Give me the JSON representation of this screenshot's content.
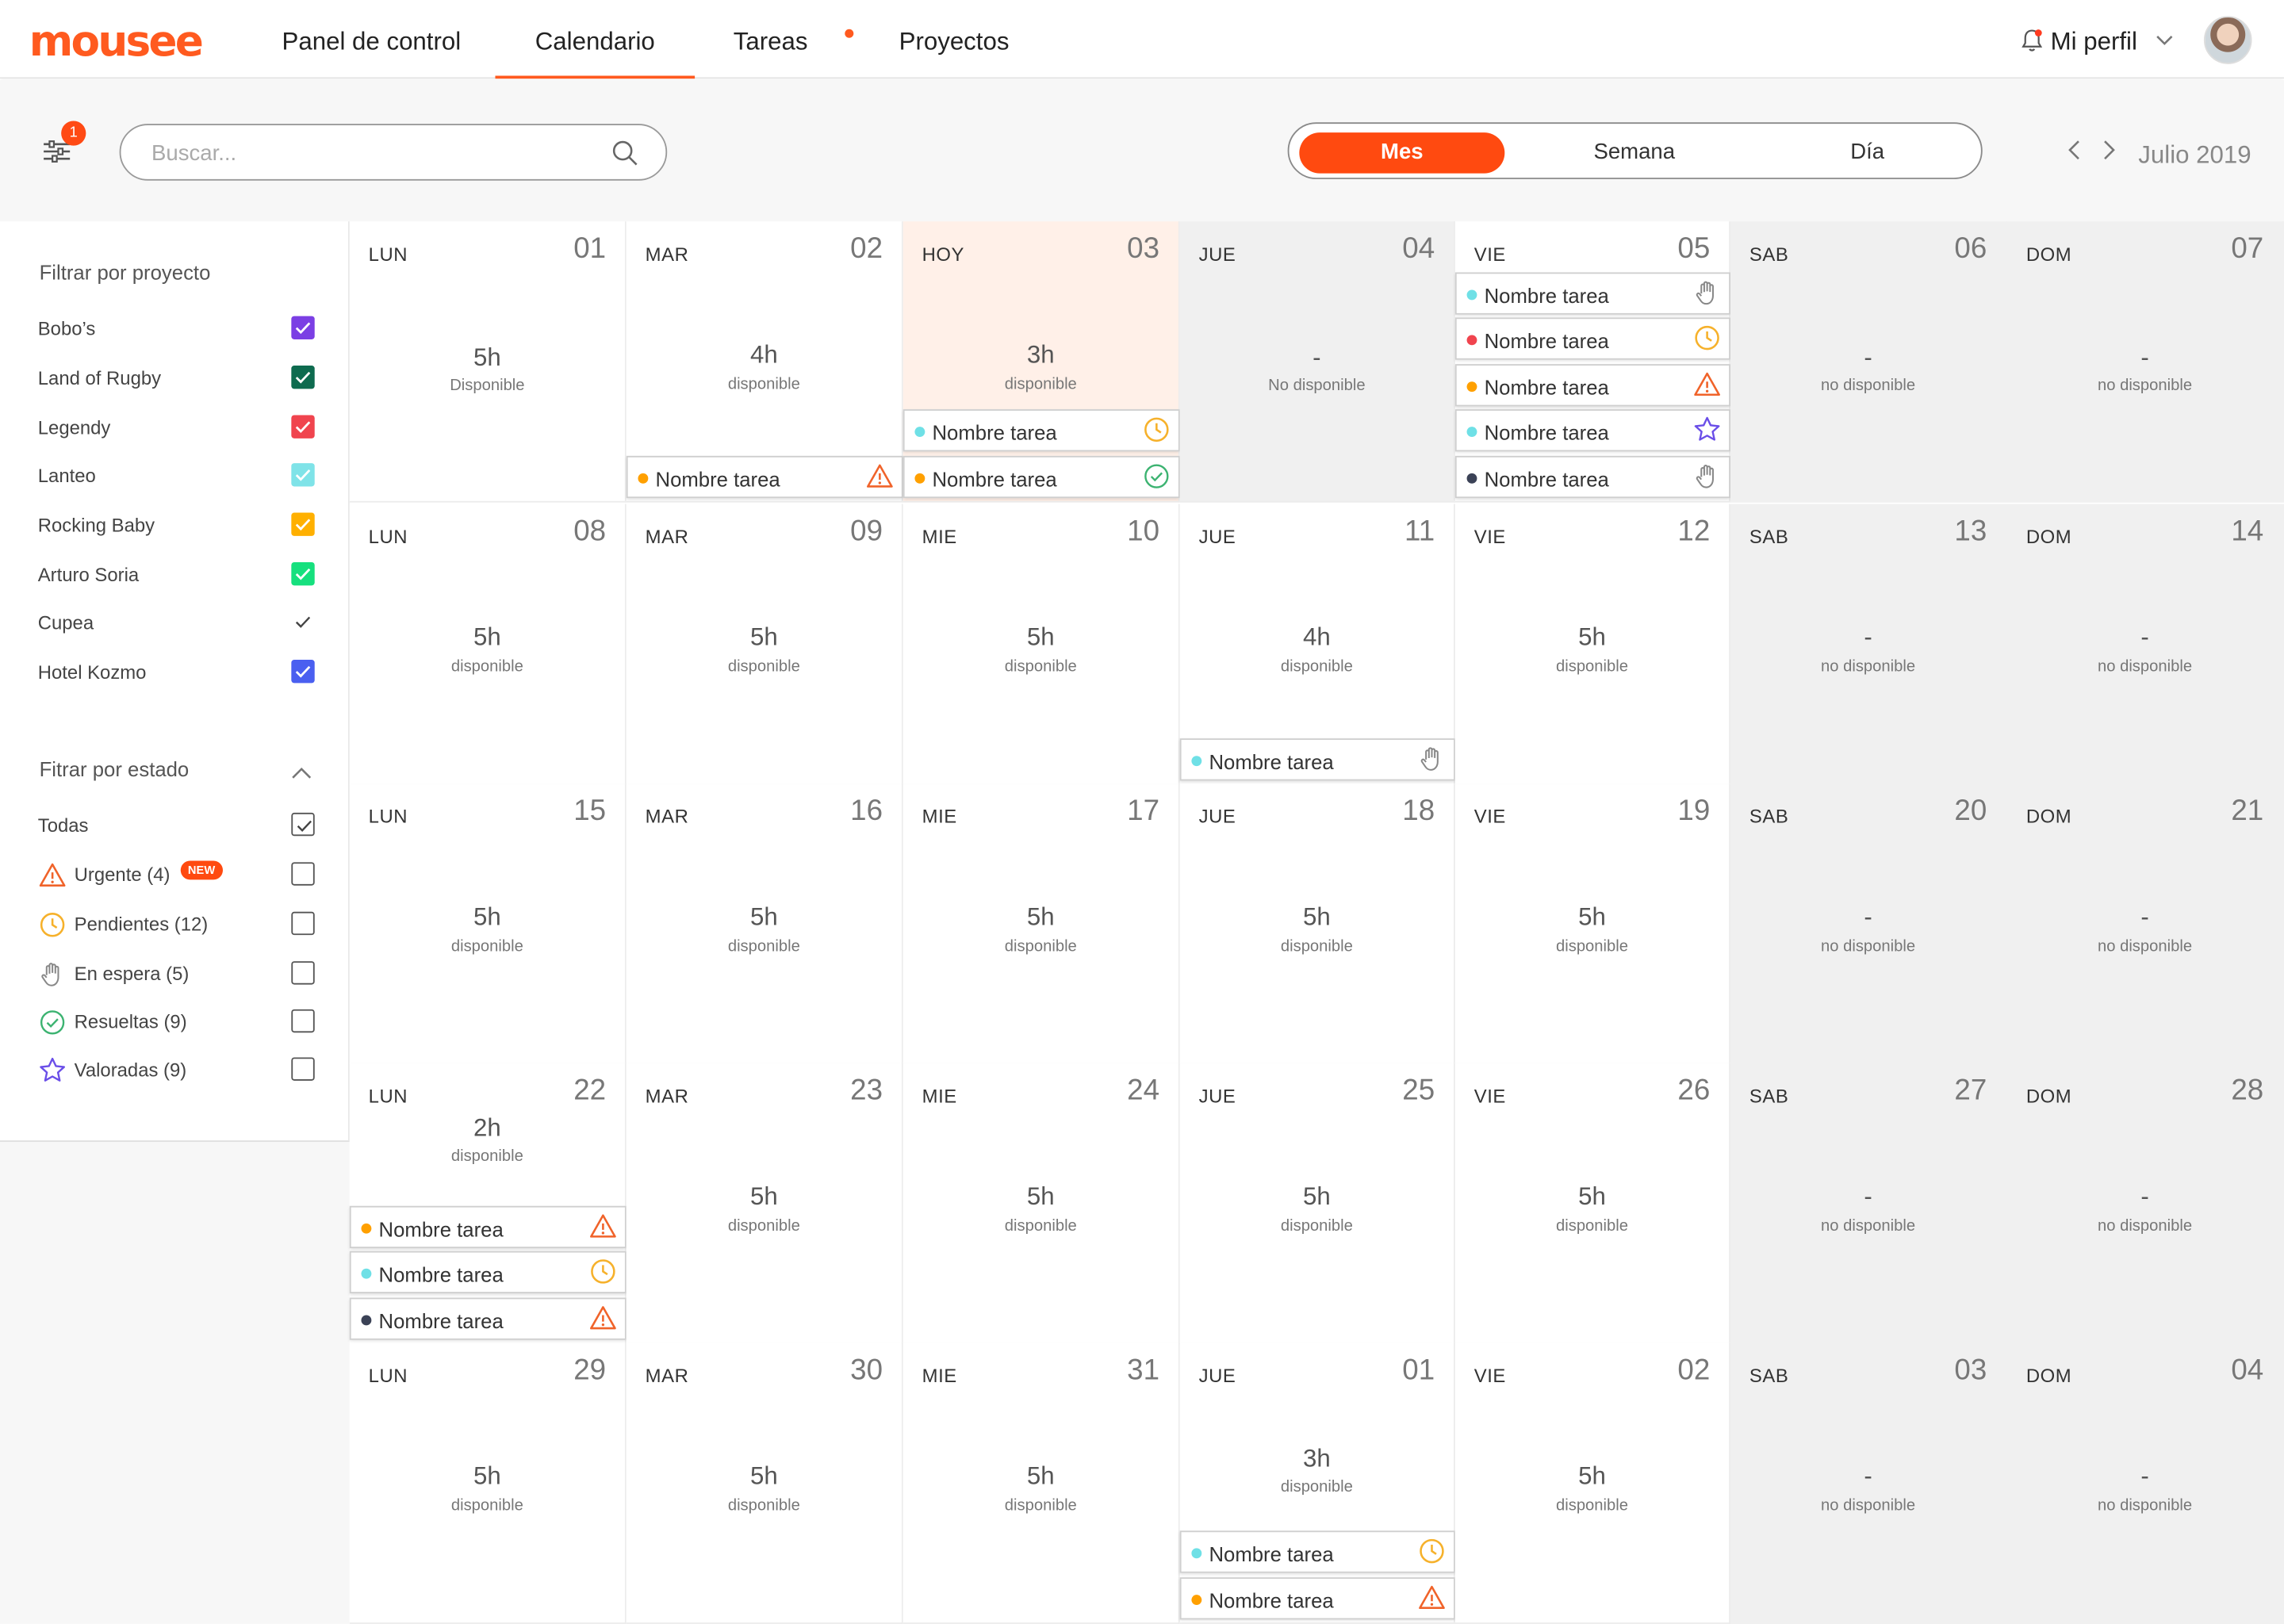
{
  "brand": {
    "logo": "mousee",
    "accent": "#ff5a1f"
  },
  "nav": {
    "items": [
      "Panel de control",
      "Calendario",
      "Tareas",
      "Proyectos"
    ],
    "active": "Calendario",
    "profile_label": "Mi perfil",
    "notification_icon": "bell-icon"
  },
  "toolbar": {
    "filter_badge": "1",
    "search_placeholder": "Buscar...",
    "views": [
      "Mes",
      "Semana",
      "Día"
    ],
    "active_view": "Mes",
    "month_label": "Julio 2019"
  },
  "sidebar": {
    "projects_title": "Filtrar por proyecto",
    "projects": [
      {
        "label": "Bobo’s",
        "color": "#7b3fe4",
        "checked": true
      },
      {
        "label": "Land of Rugby",
        "color": "#0e6b4f",
        "checked": true
      },
      {
        "label": "Legendy",
        "color": "#f0444e",
        "checked": true
      },
      {
        "label": "Lanteo",
        "color": "#7fe3e8",
        "checked": true
      },
      {
        "label": "Rocking Baby",
        "color": "#ffb000",
        "checked": true
      },
      {
        "label": "Arturo Soria",
        "color": "#16e07e",
        "checked": true
      },
      {
        "label": "Cupea",
        "color": "#ffffff",
        "checked": true
      },
      {
        "label": "Hotel Kozmo",
        "color": "#4a5ff0",
        "checked": true
      }
    ],
    "status_title": "Fitrar por estado",
    "status_all": "Todas",
    "statuses": [
      {
        "label": "Urgente (4)",
        "icon": "warning-icon",
        "badge": "NEW"
      },
      {
        "label": "Pendientes (12)",
        "icon": "clock-icon"
      },
      {
        "label": "En espera (5)",
        "icon": "hand-icon"
      },
      {
        "label": "Resueltas (9)",
        "icon": "check-circle-icon"
      },
      {
        "label": "Valoradas (9)",
        "icon": "star-icon"
      }
    ]
  },
  "calendar": {
    "weeks": [
      [
        {
          "day": "LUN",
          "num": "01",
          "hours": "5h",
          "avail": "Disponible"
        },
        {
          "day": "MAR",
          "num": "02",
          "hours": "4h",
          "avail": "disponible",
          "tasks": [
            {
              "name": "Nombre tarea",
              "dot": "#ffa000",
              "icon": "warning-icon"
            }
          ]
        },
        {
          "day": "HOY",
          "num": "03",
          "hours": "3h",
          "avail": "disponible",
          "today": true,
          "tasks": [
            {
              "name": "Nombre tarea",
              "dot": "#6fe0e6",
              "icon": "clock-icon"
            },
            {
              "name": "Nombre tarea",
              "dot": "#ffa000",
              "icon": "check-circle-icon"
            }
          ]
        },
        {
          "day": "JUE",
          "num": "04",
          "hours": "-",
          "avail": "No disponible",
          "unavailable": true
        },
        {
          "day": "VIE",
          "num": "05",
          "hours": "",
          "avail": "",
          "tasks": [
            {
              "name": "Nombre tarea",
              "dot": "#6fe0e6",
              "icon": "hand-icon"
            },
            {
              "name": "Nombre tarea",
              "dot": "#f0444e",
              "icon": "clock-icon"
            },
            {
              "name": "Nombre tarea",
              "dot": "#ffa000",
              "icon": "warning-icon"
            },
            {
              "name": "Nombre tarea",
              "dot": "#6fe0e6",
              "icon": "star-icon"
            },
            {
              "name": "Nombre tarea",
              "dot": "#3b4256",
              "icon": "hand-icon"
            }
          ]
        },
        {
          "day": "SAB",
          "num": "06",
          "hours": "-",
          "avail": "no disponible",
          "weekend": true
        },
        {
          "day": "DOM",
          "num": "07",
          "hours": "-",
          "avail": "no disponible",
          "weekend": true
        }
      ],
      [
        {
          "day": "LUN",
          "num": "08",
          "hours": "5h",
          "avail": "disponible"
        },
        {
          "day": "MAR",
          "num": "09",
          "hours": "5h",
          "avail": "disponible"
        },
        {
          "day": "MIE",
          "num": "10",
          "hours": "5h",
          "avail": "disponible"
        },
        {
          "day": "JUE",
          "num": "11",
          "hours": "4h",
          "avail": "disponible",
          "tasks": [
            {
              "name": "Nombre tarea",
              "dot": "#6fe0e6",
              "icon": "hand-icon"
            }
          ]
        },
        {
          "day": "VIE",
          "num": "12",
          "hours": "5h",
          "avail": "disponible"
        },
        {
          "day": "SAB",
          "num": "13",
          "hours": "-",
          "avail": "no disponible",
          "weekend": true
        },
        {
          "day": "DOM",
          "num": "14",
          "hours": "-",
          "avail": "no disponible",
          "weekend": true
        }
      ],
      [
        {
          "day": "LUN",
          "num": "15",
          "hours": "5h",
          "avail": "disponible"
        },
        {
          "day": "MAR",
          "num": "16",
          "hours": "5h",
          "avail": "disponible"
        },
        {
          "day": "MIE",
          "num": "17",
          "hours": "5h",
          "avail": "disponible"
        },
        {
          "day": "JUE",
          "num": "18",
          "hours": "5h",
          "avail": "disponible"
        },
        {
          "day": "VIE",
          "num": "19",
          "hours": "5h",
          "avail": "disponible"
        },
        {
          "day": "SAB",
          "num": "20",
          "hours": "-",
          "avail": "no disponible",
          "weekend": true
        },
        {
          "day": "DOM",
          "num": "21",
          "hours": "-",
          "avail": "no disponible",
          "weekend": true
        }
      ],
      [
        {
          "day": "LUN",
          "num": "22",
          "hours": "2h",
          "avail": "disponible",
          "tasks": [
            {
              "name": "Nombre tarea",
              "dot": "#ffa000",
              "icon": "warning-icon"
            },
            {
              "name": "Nombre tarea",
              "dot": "#6fe0e6",
              "icon": "clock-icon"
            },
            {
              "name": "Nombre tarea",
              "dot": "#3b4256",
              "icon": "warning-icon"
            }
          ]
        },
        {
          "day": "MAR",
          "num": "23",
          "hours": "5h",
          "avail": "disponible"
        },
        {
          "day": "MIE",
          "num": "24",
          "hours": "5h",
          "avail": "disponible"
        },
        {
          "day": "JUE",
          "num": "25",
          "hours": "5h",
          "avail": "disponible"
        },
        {
          "day": "VIE",
          "num": "26",
          "hours": "5h",
          "avail": "disponible"
        },
        {
          "day": "SAB",
          "num": "27",
          "hours": "-",
          "avail": "no disponible",
          "weekend": true
        },
        {
          "day": "DOM",
          "num": "28",
          "hours": "-",
          "avail": "no disponible",
          "weekend": true
        }
      ],
      [
        {
          "day": "LUN",
          "num": "29",
          "hours": "5h",
          "avail": "disponible"
        },
        {
          "day": "MAR",
          "num": "30",
          "hours": "5h",
          "avail": "disponible"
        },
        {
          "day": "MIE",
          "num": "31",
          "hours": "5h",
          "avail": "disponible"
        },
        {
          "day": "JUE",
          "num": "01",
          "hours": "3h",
          "avail": "disponible",
          "tasks": [
            {
              "name": "Nombre tarea",
              "dot": "#6fe0e6",
              "icon": "clock-icon"
            },
            {
              "name": "Nombre tarea",
              "dot": "#ffa000",
              "icon": "warning-icon"
            }
          ]
        },
        {
          "day": "VIE",
          "num": "02",
          "hours": "5h",
          "avail": "disponible"
        },
        {
          "day": "SAB",
          "num": "03",
          "hours": "-",
          "avail": "no disponible",
          "weekend": true
        },
        {
          "day": "DOM",
          "num": "04",
          "hours": "-",
          "avail": "no disponible",
          "weekend": true
        }
      ]
    ]
  }
}
